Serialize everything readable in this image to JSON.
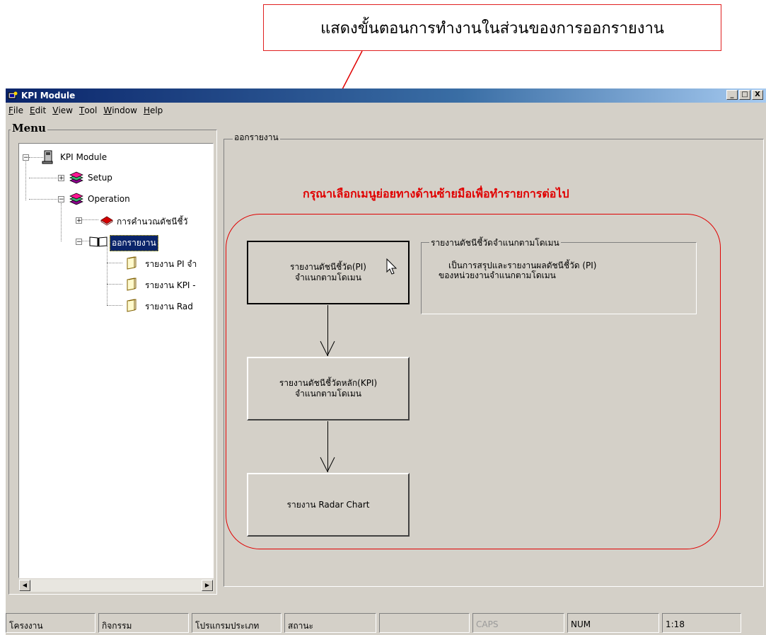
{
  "annotation": {
    "callout_text": "แสดงขั้นตอนการทำงานในส่วนของการออกรายงาน",
    "instruction_text": "กรุณาเลือกเมนูย่อยทางด้านซ้ายมือเพื่อทำรายการต่อไป",
    "color": "#e00000"
  },
  "window": {
    "title": "KPI Module",
    "controls": [
      "_",
      "□",
      "X"
    ]
  },
  "menubar": {
    "items": [
      "File",
      "Edit",
      "View",
      "Tool",
      "Window",
      "Help"
    ],
    "mnemonics": [
      "F",
      "E",
      "V",
      "T",
      "W",
      "H"
    ]
  },
  "menu_panel": {
    "caption": "Menu",
    "tree": {
      "root": "KPI Module",
      "setup": "Setup",
      "operation": "Operation",
      "calc": "การคำนวณดัชนีชี้วั",
      "report": "ออกรายงาน",
      "report_children": [
        "รายงาน PI จำ",
        "รายงาน KPI -",
        "รายงาน Rad"
      ]
    }
  },
  "report_panel": {
    "caption": "ออกรายงาน",
    "steps": [
      {
        "line1": "รายงานดัชนีชี้วัด(PI)",
        "line2": "จำแนกตามโดเมน"
      },
      {
        "line1": "รายงานดัชนีชี้วัดหลัก(KPI)",
        "line2": "จำแนกตามโดเมน"
      },
      {
        "line1": "รายงาน Radar Chart",
        "line2": ""
      }
    ],
    "description": {
      "caption": "รายงานดัชนีชี้วัดจำแนกตามโดเมน",
      "line1": "เป็นการสรุปและรายงานผลดัชนีชี้วัด (PI)",
      "line2": "ของหน่วยงานจำแนกตามโดเมน"
    }
  },
  "statusbar": {
    "panels": [
      "โครงงาน",
      "กิจกรรม",
      "โปรแกรมประเภท",
      "สถานะ",
      "",
      "CAPS",
      "NUM",
      "1:18"
    ]
  }
}
